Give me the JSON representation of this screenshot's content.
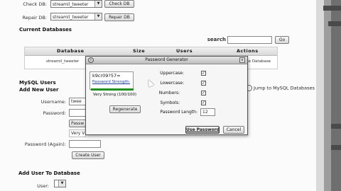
{
  "top": {
    "check_label": "Check DB:",
    "check_value": "streamil_tweeter",
    "check_button": "Check DB",
    "repair_label": "Repair DB:",
    "repair_value": "streamil_tweeter",
    "repair_button": "Repair DB"
  },
  "current_databases": {
    "title": "Current Databases",
    "search_label": "search",
    "search_value": "",
    "go_button": "Go",
    "columns": [
      "Database",
      "Size",
      "Users",
      "Actions"
    ],
    "row": {
      "database": "streamil_tweeter",
      "actions": "Delete Database"
    }
  },
  "mysql_users": {
    "title": "MySQL Users",
    "add_new_user": "Add New User",
    "username_label": "Username:",
    "username_value": "twee",
    "password_label": "Password:",
    "password_value": "",
    "password_generator_value": "Passw",
    "strength_value": "Very V",
    "password_again_label": "Password (Again):",
    "password_again_value": "",
    "create_button": "Create User",
    "jump_link": "Jump to MySQL Databases"
  },
  "add_user_to_db": {
    "title": "Add User To Database",
    "user_label": "User:",
    "user_value": ""
  },
  "dialog": {
    "title": "Password Generator",
    "password": "k9cr09?57=",
    "strength_label": "Password Strength:",
    "strength_text": "Very Strong (100/100)",
    "strength_percent": 100,
    "regenerate_button": "Regenerate",
    "options": [
      {
        "label": "Uppercase:",
        "checked": true
      },
      {
        "label": "Lowercase:",
        "checked": true
      },
      {
        "label": "Numbers:",
        "checked": true
      },
      {
        "label": "Symbols:",
        "checked": true
      }
    ],
    "length_label": "Password Length:",
    "length_value": "12",
    "use_button": "Use Password",
    "cancel_button": "Cancel",
    "check_glyph": "✓",
    "close_glyph": "x",
    "icon_glyph": "i"
  }
}
